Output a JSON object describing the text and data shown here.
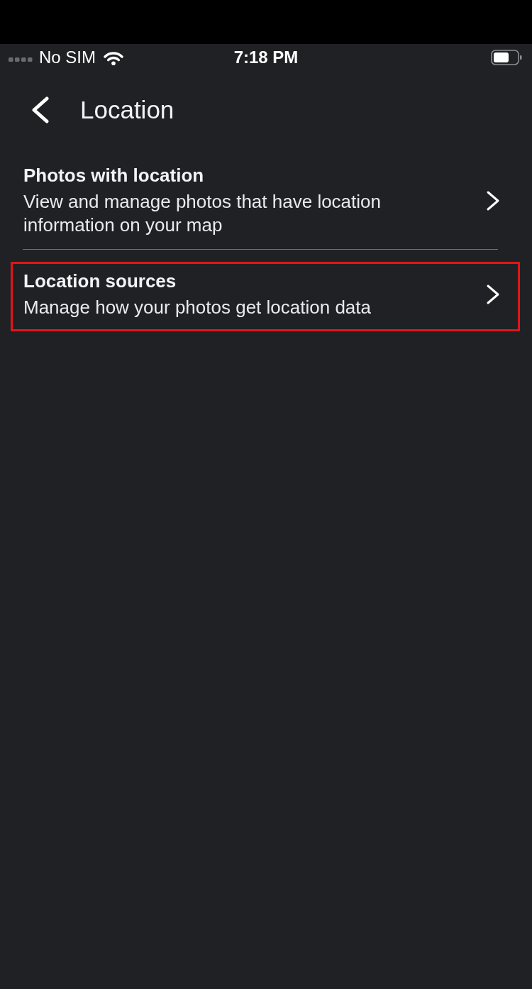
{
  "status_bar": {
    "carrier": "No SIM",
    "time": "7:18 PM"
  },
  "header": {
    "title": "Location"
  },
  "items": [
    {
      "title": "Photos with location",
      "subtitle": "View and manage photos that have location information on your map",
      "highlighted": false
    },
    {
      "title": "Location sources",
      "subtitle": "Manage how your photos get location data",
      "highlighted": true
    }
  ]
}
